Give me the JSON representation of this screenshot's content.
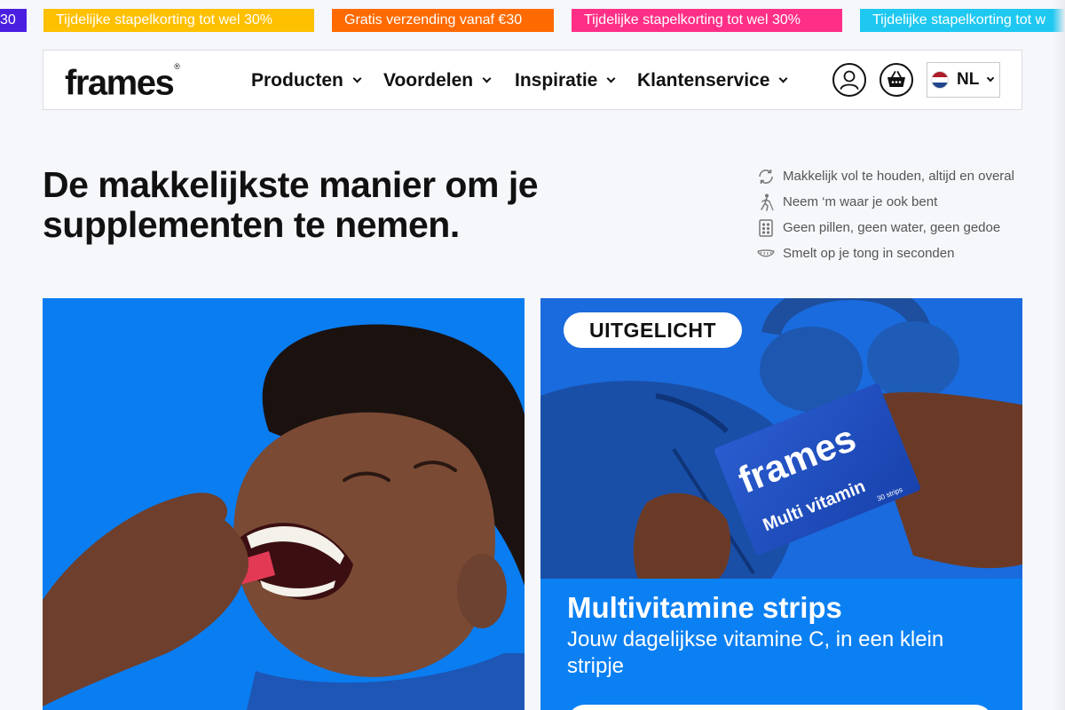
{
  "promo_bar": {
    "items": [
      {
        "text": "30",
        "color": "#4b1fe0"
      },
      {
        "text": "Tijdelijke stapelkorting tot wel 30%",
        "color": "#ffc000"
      },
      {
        "text": "Gratis verzending vanaf €30",
        "color": "#ff6a00"
      },
      {
        "text": "Tijdelijke stapelkorting tot wel 30%",
        "color": "#ff2f87"
      },
      {
        "text": "Tijdelijke stapelkorting tot w",
        "color": "#1ec8f0"
      }
    ]
  },
  "header": {
    "logo": "frames",
    "logo_mark": "®",
    "nav": [
      {
        "label": "Producten"
      },
      {
        "label": "Voordelen"
      },
      {
        "label": "Inspiratie"
      },
      {
        "label": "Klantenservice"
      }
    ],
    "account_icon": "user-icon",
    "cart_icon": "basket-icon",
    "language": {
      "code": "NL",
      "flag_colors": [
        "#ae1c28",
        "#ffffff",
        "#21468b"
      ]
    }
  },
  "hero": {
    "title": "De makkelijkste manier om je supplementen te nemen.",
    "benefits": [
      {
        "icon": "refill-icon",
        "text": "Makkelijk vol te houden, altijd en overal"
      },
      {
        "icon": "walking-icon",
        "text": "Neem ‘m waar je ook bent"
      },
      {
        "icon": "pills-icon",
        "text": "Geen pillen, geen water, geen gedoe"
      },
      {
        "icon": "tongue-icon",
        "text": "Smelt op je tong in seconden"
      }
    ]
  },
  "featured": {
    "badge": "UITGELICHT",
    "title": "Multivitamine strips",
    "subtitle": "Jouw dagelijkse vitamine C, in een klein stripje",
    "package_brand": "frames",
    "package_product": "Multi vitamin",
    "package_count": "30 strips"
  },
  "colors": {
    "accent_blue": "#0b80f3",
    "text": "#111111",
    "muted": "#555555"
  }
}
